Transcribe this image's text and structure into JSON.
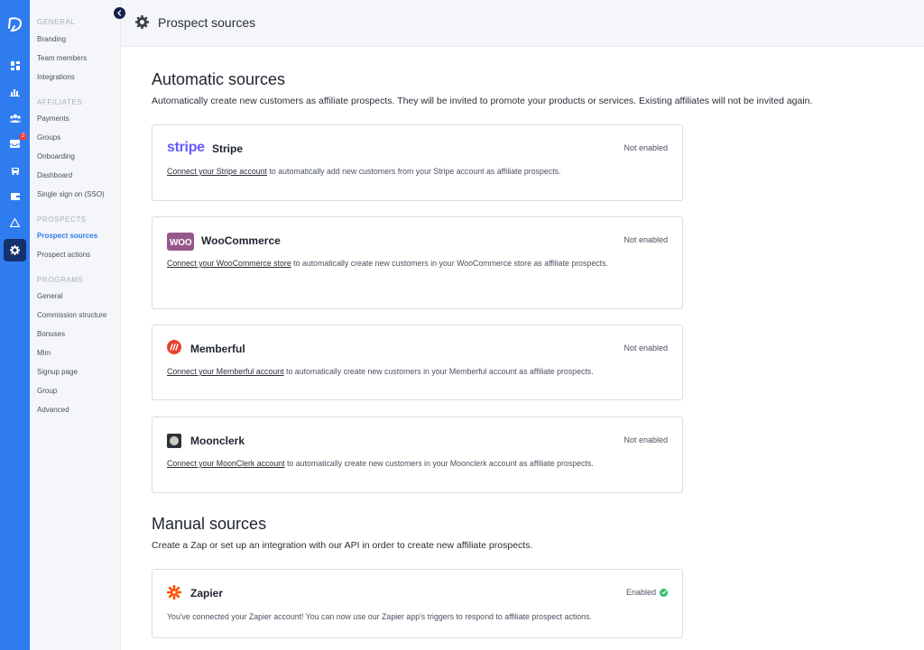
{
  "rail": {
    "items": [
      {
        "icon": "dashboard-icon"
      },
      {
        "icon": "chart-icon"
      },
      {
        "icon": "users-icon"
      },
      {
        "icon": "inbox-icon",
        "badge": "2"
      },
      {
        "icon": "car-icon"
      },
      {
        "icon": "wallet-icon"
      },
      {
        "icon": "warning-icon"
      },
      {
        "icon": "settings-icon",
        "active": true
      }
    ]
  },
  "sidebar": {
    "sections": [
      {
        "title": "GENERAL",
        "items": [
          "Branding",
          "Team members",
          "Integrations"
        ]
      },
      {
        "title": "AFFILIATES",
        "items": [
          "Payments",
          "Groups",
          "Onboarding",
          "Dashboard",
          "Single sign on (SSO)"
        ]
      },
      {
        "title": "PROSPECTS",
        "items": [
          "Prospect sources",
          "Prospect actions"
        ]
      },
      {
        "title": "PROGRAMS",
        "items": [
          "General",
          "Commission structure",
          "Bonuses",
          "Mlm",
          "Signup page",
          "Group",
          "Advanced"
        ]
      }
    ],
    "active_item": "Prospect sources"
  },
  "header": {
    "title": "Prospect sources"
  },
  "automatic": {
    "heading": "Automatic sources",
    "description": "Automatically create new customers as affiliate prospects. They will be invited to promote your products or services. Existing affiliates will not be invited again.",
    "cards": [
      {
        "name": "Stripe",
        "logo_text": "stripe",
        "status": "Not enabled",
        "link": "Connect your Stripe account",
        "text": " to automatically add new customers from your Stripe account as affiliate prospects."
      },
      {
        "name": "WooCommerce",
        "logo_text": "WOO",
        "status": "Not enabled",
        "link": "Connect your WooCommerce store",
        "text": " to automatically create new customers in your WooCommerce store as affiliate prospects."
      },
      {
        "name": "Memberful",
        "status": "Not enabled",
        "link": "Connect your Memberful account",
        "text": " to automatically create new customers in your Memberful account as affiliate prospects."
      },
      {
        "name": "Moonclerk",
        "status": "Not enabled",
        "link": "Connect your MoonClerk account",
        "text": " to automatically create new customers in your Moonclerk account as affiliate prospects."
      }
    ]
  },
  "manual": {
    "heading": "Manual sources",
    "description": "Create a Zap or set up an integration with our API in order to create new affiliate prospects.",
    "cards": [
      {
        "name": "Zapier",
        "status": "Enabled",
        "text": "You've connected your Zapier account! You can now use our Zapier app's triggers to respond to affiliate prospect actions."
      }
    ]
  },
  "colors": {
    "accent": "#2f7bf0",
    "rail": "#2f7bf0",
    "active_rail": "#14306d",
    "stripe": "#635bff",
    "woo": "#96588a",
    "memberful": "#e8412c",
    "zapier": "#ff4f00",
    "enabled": "#2fbf71"
  }
}
